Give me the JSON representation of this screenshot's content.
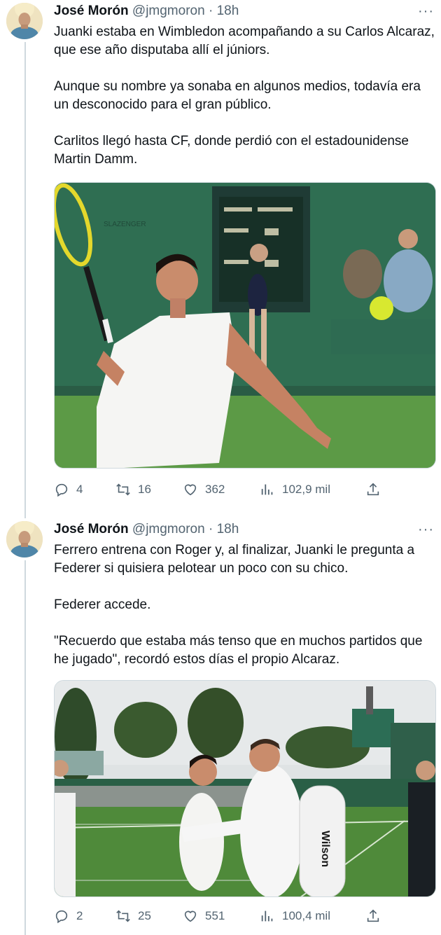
{
  "tweets": [
    {
      "author": {
        "name": "José Morón",
        "handle": "@jmgmoron",
        "time": "18h"
      },
      "text": "Juanki estaba en Wimbledon acompañando a su Carlos Alcaraz, que ese año disputaba allí el júniors.\n\nAunque su nombre ya sonaba en algunos medios, todavía era un desconocido para el gran público.\n\nCarlitos llegó hasta CF, donde perdió con el estadounidense Martin Damm.",
      "media": {
        "scoreboard_text": "SLAZENGER"
      },
      "stats": {
        "replies": "4",
        "retweets": "16",
        "likes": "362",
        "views": "102,9 mil"
      }
    },
    {
      "author": {
        "name": "José Morón",
        "handle": "@jmgmoron",
        "time": "18h"
      },
      "text": "Ferrero entrena con Roger y, al finalizar, Juanki le pregunta a Federer si quisiera pelotear un poco con su chico.\n\nFederer accede.\n\n\"Recuerdo que estaba más tenso que en muchos partidos que he jugado\", recordó estos días el propio Alcaraz.",
      "media": {
        "bag_brand": "Wilson"
      },
      "stats": {
        "replies": "2",
        "retweets": "25",
        "likes": "551",
        "views": "100,4 mil"
      }
    }
  ],
  "ui": {
    "more_icon": "···",
    "separator": "·"
  },
  "colors": {
    "text": "#0f1419",
    "secondary": "#536471",
    "thread_line": "#cfd9de",
    "grass": "#4f8a3a"
  }
}
